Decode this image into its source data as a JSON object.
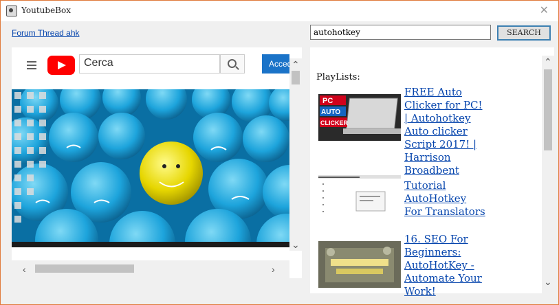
{
  "window": {
    "title": "YoutubeBox"
  },
  "header": {
    "forum_link": "Forum Thread ahk",
    "search_value": "autohotkey",
    "search_button": "SEARCH"
  },
  "youtube": {
    "search_placeholder": "Cerca",
    "access_button": "Accedi"
  },
  "results": {
    "label": "PlayLists:",
    "items": [
      {
        "title": "FREE Auto Clicker for PC! | Autohotkey Auto clicker Script 2017! | Harrison Broadbent",
        "thumb_text_1": "PC",
        "thumb_text_2": "AUTO",
        "thumb_text_3": "CLICKER"
      },
      {
        "title": "Tutorial AutoHotkey For Translators"
      },
      {
        "title": "16. SEO For Beginners: AutoHotKey - Automate Your Work!"
      }
    ]
  },
  "colors": {
    "accent": "#0645ad",
    "youtube_red": "#ff0000",
    "window_border": "#e07a3a"
  }
}
